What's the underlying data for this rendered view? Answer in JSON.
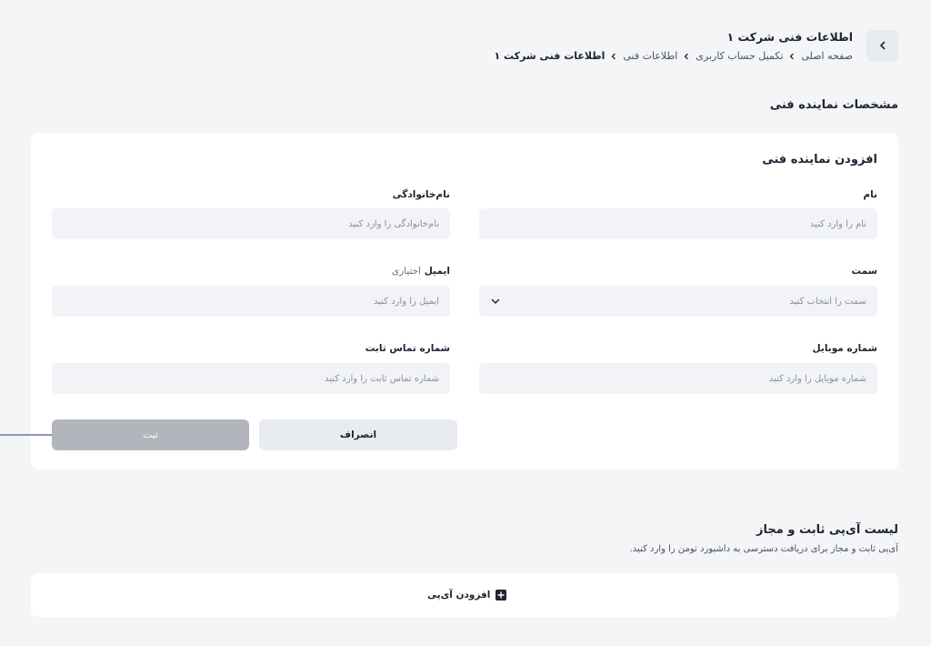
{
  "header": {
    "title": "اطلاعات فنی شرکت ۱",
    "breadcrumb": [
      "صفحه اصلی",
      "تکمیل حساب کاربری",
      "اطلاعات فنی",
      "اطلاعات فنی شرکت ۱"
    ],
    "back_icon": "chevron-left-icon"
  },
  "section": {
    "title": "مشخصات نماینده فنی"
  },
  "form": {
    "title": "افزودن نماینده فنی",
    "first_name": {
      "label": "نام",
      "placeholder": "نام را وارد کنید"
    },
    "last_name": {
      "label": "نام‌خانوادگی",
      "placeholder": "نام‌خانوادگی را وارد کنید"
    },
    "position": {
      "label": "سمت",
      "placeholder": "سمت را انتخاب کنید"
    },
    "email": {
      "label": "ایمیل",
      "optional": "اختیاری",
      "placeholder": "ایمیل را وارد کنید"
    },
    "mobile": {
      "label": "شماره موبایل",
      "placeholder": "شماره موبایل را وارد کنید"
    },
    "landline": {
      "label": "شماره تماس ثابت",
      "placeholder": "شماره تماس ثابت را وارد کنید"
    },
    "cancel_label": "انصراف",
    "submit_label": "ثبت"
  },
  "ip_section": {
    "title": "لیست آی‌پی ثابت و مجاز",
    "description": "آی‌پی ثابت و مجاز برای دریافت دسترسی به داشبورد تومن را وارد کنید.",
    "add_label": "افزودن آی‌پی"
  },
  "colors": {
    "background": "#f4f5f7",
    "card": "#ffffff",
    "input_bg": "#f1f3f6",
    "submit_disabled": "#b2b5bb",
    "cancel_bg": "#e8ebf0",
    "text_dark": "#1f2430"
  }
}
